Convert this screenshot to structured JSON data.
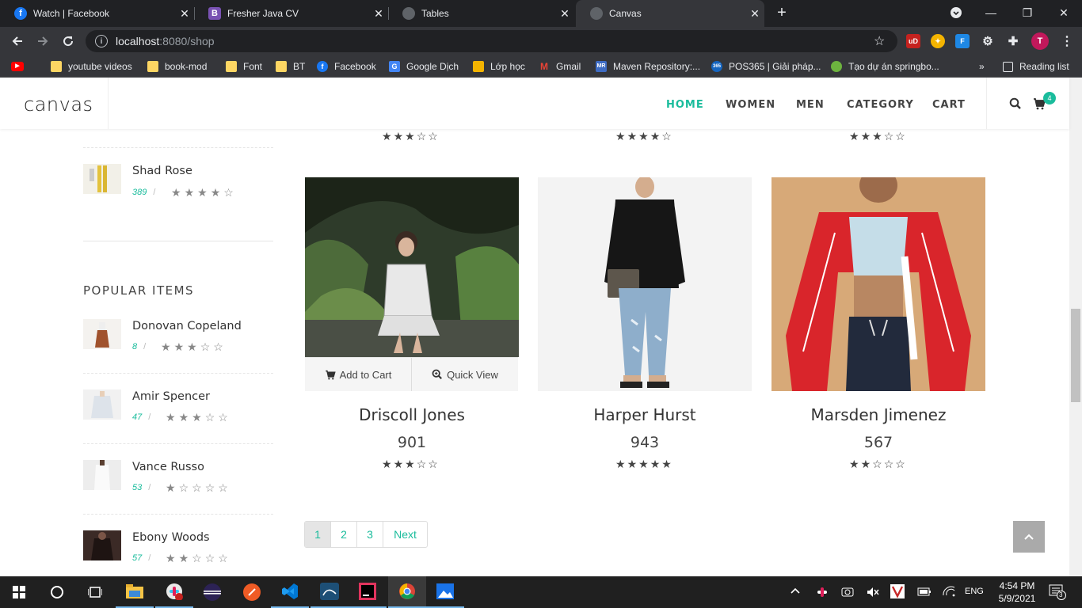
{
  "browser": {
    "tabs": [
      {
        "title": "Watch | Facebook",
        "icon": "facebook-icon",
        "color": "#1877f2",
        "glyph": "f"
      },
      {
        "title": "Fresher Java CV",
        "icon": "bootstrap-icon",
        "color": "#7952b3",
        "glyph": "B"
      },
      {
        "title": "Tables",
        "icon": "globe-icon",
        "color": "#5f6368",
        "glyph": ""
      },
      {
        "title": "Canvas",
        "icon": "globe-icon",
        "color": "#5f6368",
        "glyph": ""
      }
    ],
    "url_host": "localhost",
    "url_rest": ":8080/shop",
    "profile_initial": "T",
    "bookmarks": [
      {
        "label": "",
        "icon": "youtube-icon"
      },
      {
        "label": "youtube videos",
        "icon": "folder-icon"
      },
      {
        "label": "book-mod",
        "icon": "folder-icon"
      },
      {
        "label": "Font",
        "icon": "folder-icon"
      },
      {
        "label": "BT",
        "icon": "folder-icon"
      },
      {
        "label": "Facebook",
        "icon": "facebook-icon"
      },
      {
        "label": "Google Dịch",
        "icon": "google-translate-icon"
      },
      {
        "label": "Lớp học",
        "icon": "classroom-icon"
      },
      {
        "label": "Gmail",
        "icon": "gmail-icon"
      },
      {
        "label": "Maven Repository:...",
        "icon": "maven-icon"
      },
      {
        "label": "POS365 | Giải pháp...",
        "icon": "pos365-icon"
      },
      {
        "label": "Tạo dự án springbo...",
        "icon": "spring-icon"
      }
    ],
    "overflow": "»",
    "reading_list": "Reading list"
  },
  "site": {
    "logo": "canvas",
    "nav": [
      "HOME",
      "WOMEN",
      "MEN",
      "CATEGORY",
      "CART"
    ],
    "cart_count": "4",
    "accent": "#1abc9c"
  },
  "sidebar": {
    "top_item": {
      "name": "Shad Rose",
      "price": "389",
      "rating": 4
    },
    "popular_title": "POPULAR ITEMS",
    "items": [
      {
        "name": "Donovan Copeland",
        "price": "8",
        "rating": 3
      },
      {
        "name": "Amir Spencer",
        "price": "47",
        "rating": 3
      },
      {
        "name": "Vance Russo",
        "price": "53",
        "rating": 1
      },
      {
        "name": "Ebony Woods",
        "price": "57",
        "rating": 2
      }
    ]
  },
  "products": {
    "top_row_ratings": [
      3,
      4,
      3
    ],
    "items": [
      {
        "name": "Driscoll Jones",
        "price": "901",
        "rating": 3
      },
      {
        "name": "Harper Hurst",
        "price": "943",
        "rating": 5
      },
      {
        "name": "Marsden Jimenez",
        "price": "567",
        "rating": 2
      }
    ],
    "add_to_cart": "Add to Cart",
    "quick_view": "Quick View"
  },
  "pagination": {
    "pages": [
      "1",
      "2",
      "3"
    ],
    "next": "Next",
    "current": "1"
  },
  "taskbar": {
    "time": "4:54 PM",
    "date": "5/9/2021",
    "lang": "ENG",
    "notifications": "3"
  }
}
